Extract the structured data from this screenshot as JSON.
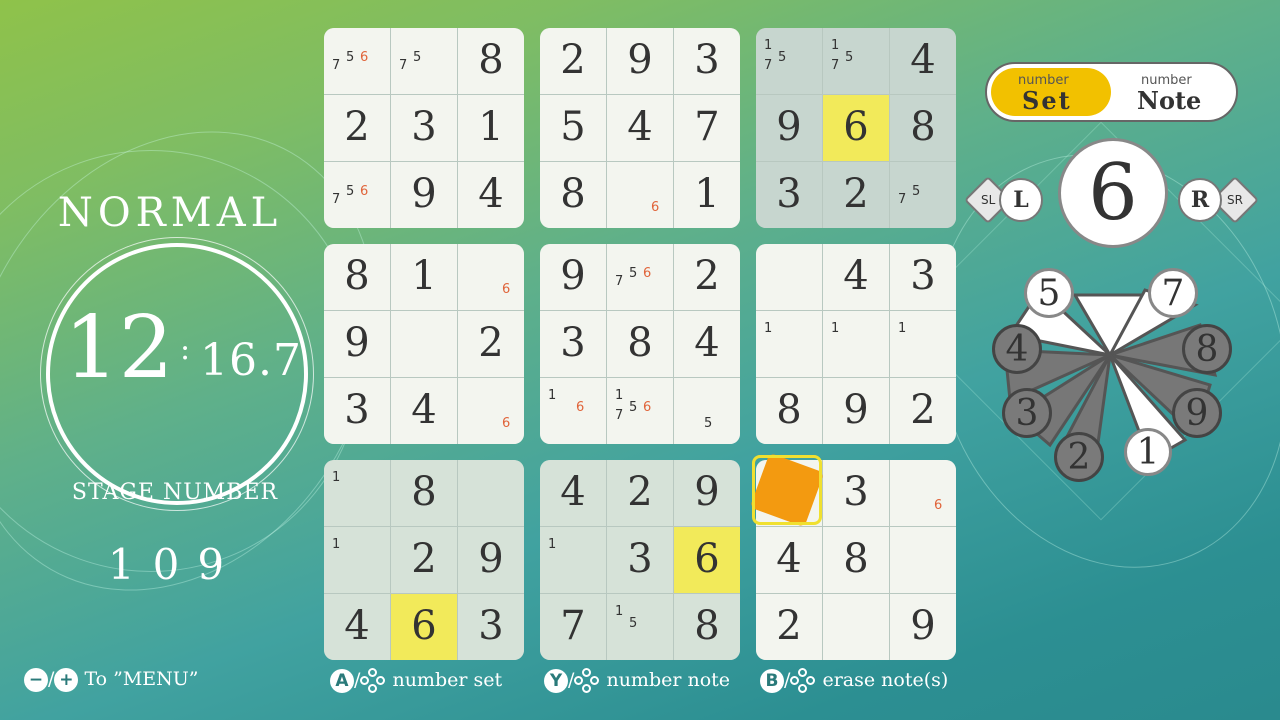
{
  "difficulty": "NORMAL",
  "timer": {
    "minutes": "12",
    "seconds": "16.7"
  },
  "stage": {
    "label": "STAGE NUMBER",
    "number": "109"
  },
  "mode": {
    "set_small": "number",
    "set_large": "Set",
    "note_small": "number",
    "note_large": "Note",
    "active": "Set"
  },
  "selected_number": "6",
  "shoulder": {
    "left": "L",
    "left_tab": "SL",
    "right": "R",
    "right_tab": "SR"
  },
  "wheel_numbers": [
    "1",
    "2",
    "3",
    "4",
    "5",
    "6",
    "7",
    "8",
    "9"
  ],
  "footer": {
    "menu": "To ”MENU”",
    "set": "number set",
    "note": "number note",
    "erase": "erase note(s)",
    "btn_a": "A",
    "btn_y": "Y",
    "btn_b": "B",
    "btn_minus": "−",
    "btn_plus": "+"
  },
  "grid": [
    [
      "",
      "",
      "8",
      "2",
      "9",
      "3",
      "",
      "",
      "4"
    ],
    [
      "2",
      "3",
      "1",
      "5",
      "4",
      "7",
      "9",
      "6",
      "8"
    ],
    [
      "",
      "9",
      "4",
      "8",
      "",
      "1",
      "3",
      "2",
      ""
    ],
    [
      "8",
      "1",
      "",
      "9",
      "",
      "2",
      "",
      "4",
      "3"
    ],
    [
      "9",
      "",
      "2",
      "3",
      "8",
      "4",
      "",
      "",
      ""
    ],
    [
      "3",
      "4",
      "",
      "",
      "",
      "",
      "8",
      "9",
      "2"
    ],
    [
      "",
      "8",
      "",
      "4",
      "2",
      "9",
      "",
      "3",
      ""
    ],
    [
      "",
      "2",
      "9",
      "",
      "3",
      "6",
      "4",
      "8",
      ""
    ],
    [
      "4",
      "6",
      "3",
      "7",
      "",
      "8",
      "2",
      "",
      "9"
    ]
  ],
  "notes": {
    "0-0": [
      "7",
      "5",
      "6"
    ],
    "0-1": [
      "7",
      "5"
    ],
    "0-6": [
      "1",
      "5",
      "7"
    ],
    "0-7": [
      "1",
      "7",
      "5"
    ],
    "2-0": [
      "7",
      "5",
      "6"
    ],
    "2-4": [
      "6"
    ],
    "2-8": [
      "7",
      "5"
    ],
    "3-2": [
      "6"
    ],
    "3-4": [
      "7",
      "5",
      "6"
    ],
    "4-6": [
      "1"
    ],
    "4-7": [
      "1"
    ],
    "4-8": [
      "1"
    ],
    "5-2": [
      "6"
    ],
    "5-3": [
      "1",
      "6"
    ],
    "5-4": [
      "1",
      "7",
      "5",
      "6"
    ],
    "5-5": [
      "5"
    ],
    "6-0": [
      "1"
    ],
    "6-6": [
      "6"
    ],
    "6-8": [
      "6"
    ],
    "7-0": [
      "1"
    ],
    "7-3": [
      "1"
    ],
    "8-4": [
      "1",
      "5"
    ]
  }
}
